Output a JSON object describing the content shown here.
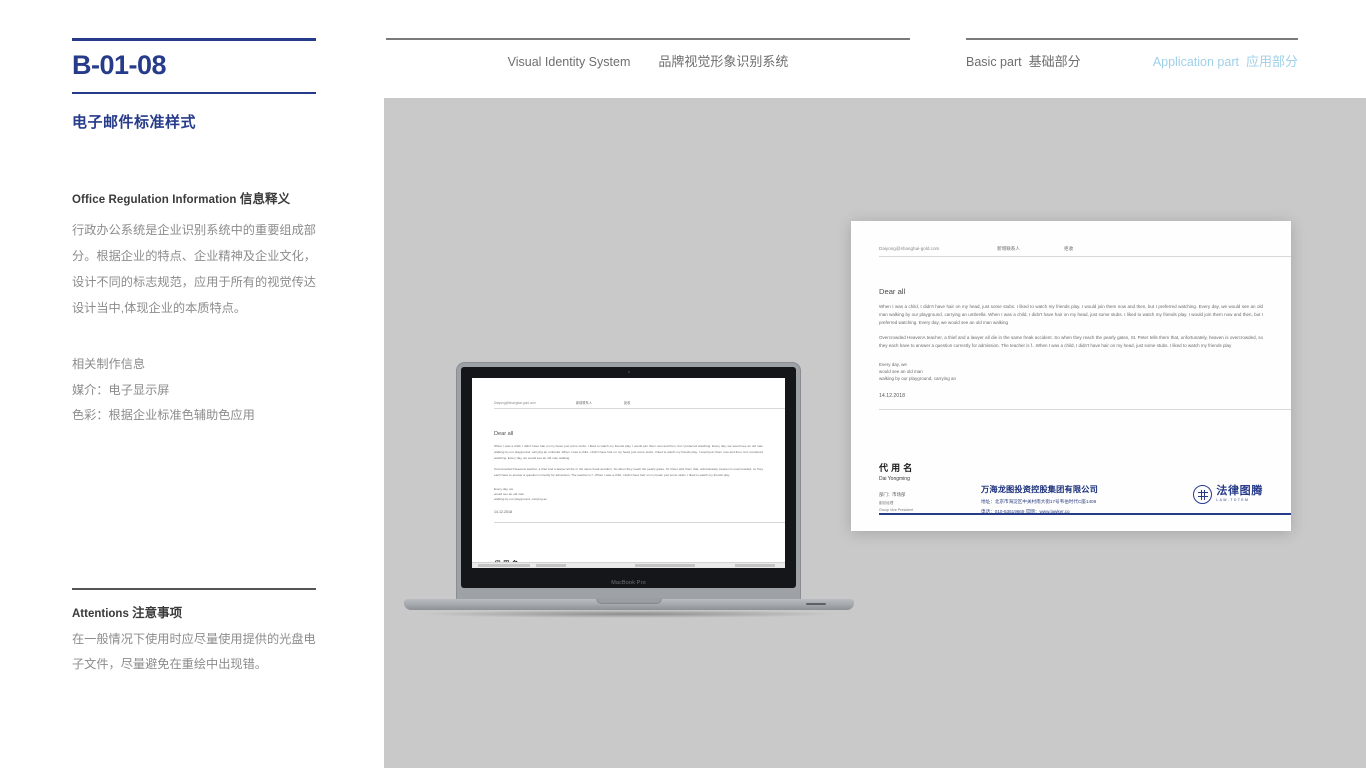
{
  "sidebar": {
    "code": "B-01-08",
    "subtitle": "电子邮件标准样式",
    "section_head_en": "Office Regulation Information",
    "section_head_cn": "信息释义",
    "body_paragraph": "行政办公系统是企业识别系统中的重要组成部分。根据企业的特点、企业精神及企业文化，设计不同的标志规范，应用于所有的视觉传达设计当中,体现企业的本质特点。",
    "meta_title": "相关制作信息",
    "meta_medium": "媒介：电子显示屏",
    "meta_color": "色彩：根据企业标准色辅助色应用",
    "attentions_head_en": "Attentions",
    "attentions_head_cn": "注意事项",
    "attentions_body": "在一般情况下使用时应尽量使用提供的光盘电子文件，尽量避免在重绘中出现错。"
  },
  "nav": {
    "left_en": "Visual Identity System",
    "left_cn": "品牌视觉形象识别系统",
    "basic_en": "Basic part",
    "basic_cn": "基础部分",
    "application_en": "Application part",
    "application_cn": "应用部分"
  },
  "email": {
    "address": "Daiyong@shanghai-gold.com",
    "action_add": "新增联系人",
    "action_reject": "拒收",
    "greeting": "Dear all",
    "paragraph1": "When I was a child, I didn't have hair on my head, just some stubs. I liked to watch my friends play. I would join them now and then, but I preferred watching. Every day, we would see an old man walking by our playground, carrying an umbrella. When I was a child, I didn't have hair on my head, just some stubs. I liked to watch my friends play. I would join them now and then, but I preferred watching. Every day, we would see an old man walking",
    "paragraph2": "Overcrowded HeavenA teacher, a thief and a lawyer all die in the same freak accident. So when they reach the pearly gates, St. Peter tells them that, unfortunately, heaven is overcrowded, so they each have to answer a question correctly for admission. The teacher is f...When I was a child, I didn't have hair on my head, just some stubs. I liked to watch my friends play",
    "closing_line1": "Every day, we",
    "closing_line2": "would see an old man",
    "closing_line3": "walking by our playground, carrying an",
    "date": "14.12.2018",
    "signature_name_cn": "代用名",
    "signature_name_en": "Dai Yongming",
    "signature_dept": "部门：市场部",
    "signature_title_cn": "副总经理",
    "signature_title_en": "Group Vice President",
    "company_name": "万海龙图投资控股集团有限公司",
    "company_address": "地址：北京市海淀区中关村南大街17号韦伯时代C座1408",
    "company_contact": "电话：010-53519669    官网：www.lawker.co",
    "logo_cn": "法律图腾",
    "logo_en": "LAW-TOTEM"
  },
  "device": {
    "model_label": "MacBook Pro"
  },
  "colors": {
    "navy": "#263b8a",
    "canvas_gray": "#c9c9c9",
    "muted_text": "#8c8c8c",
    "accent_light_blue": "#9fd0e8"
  }
}
